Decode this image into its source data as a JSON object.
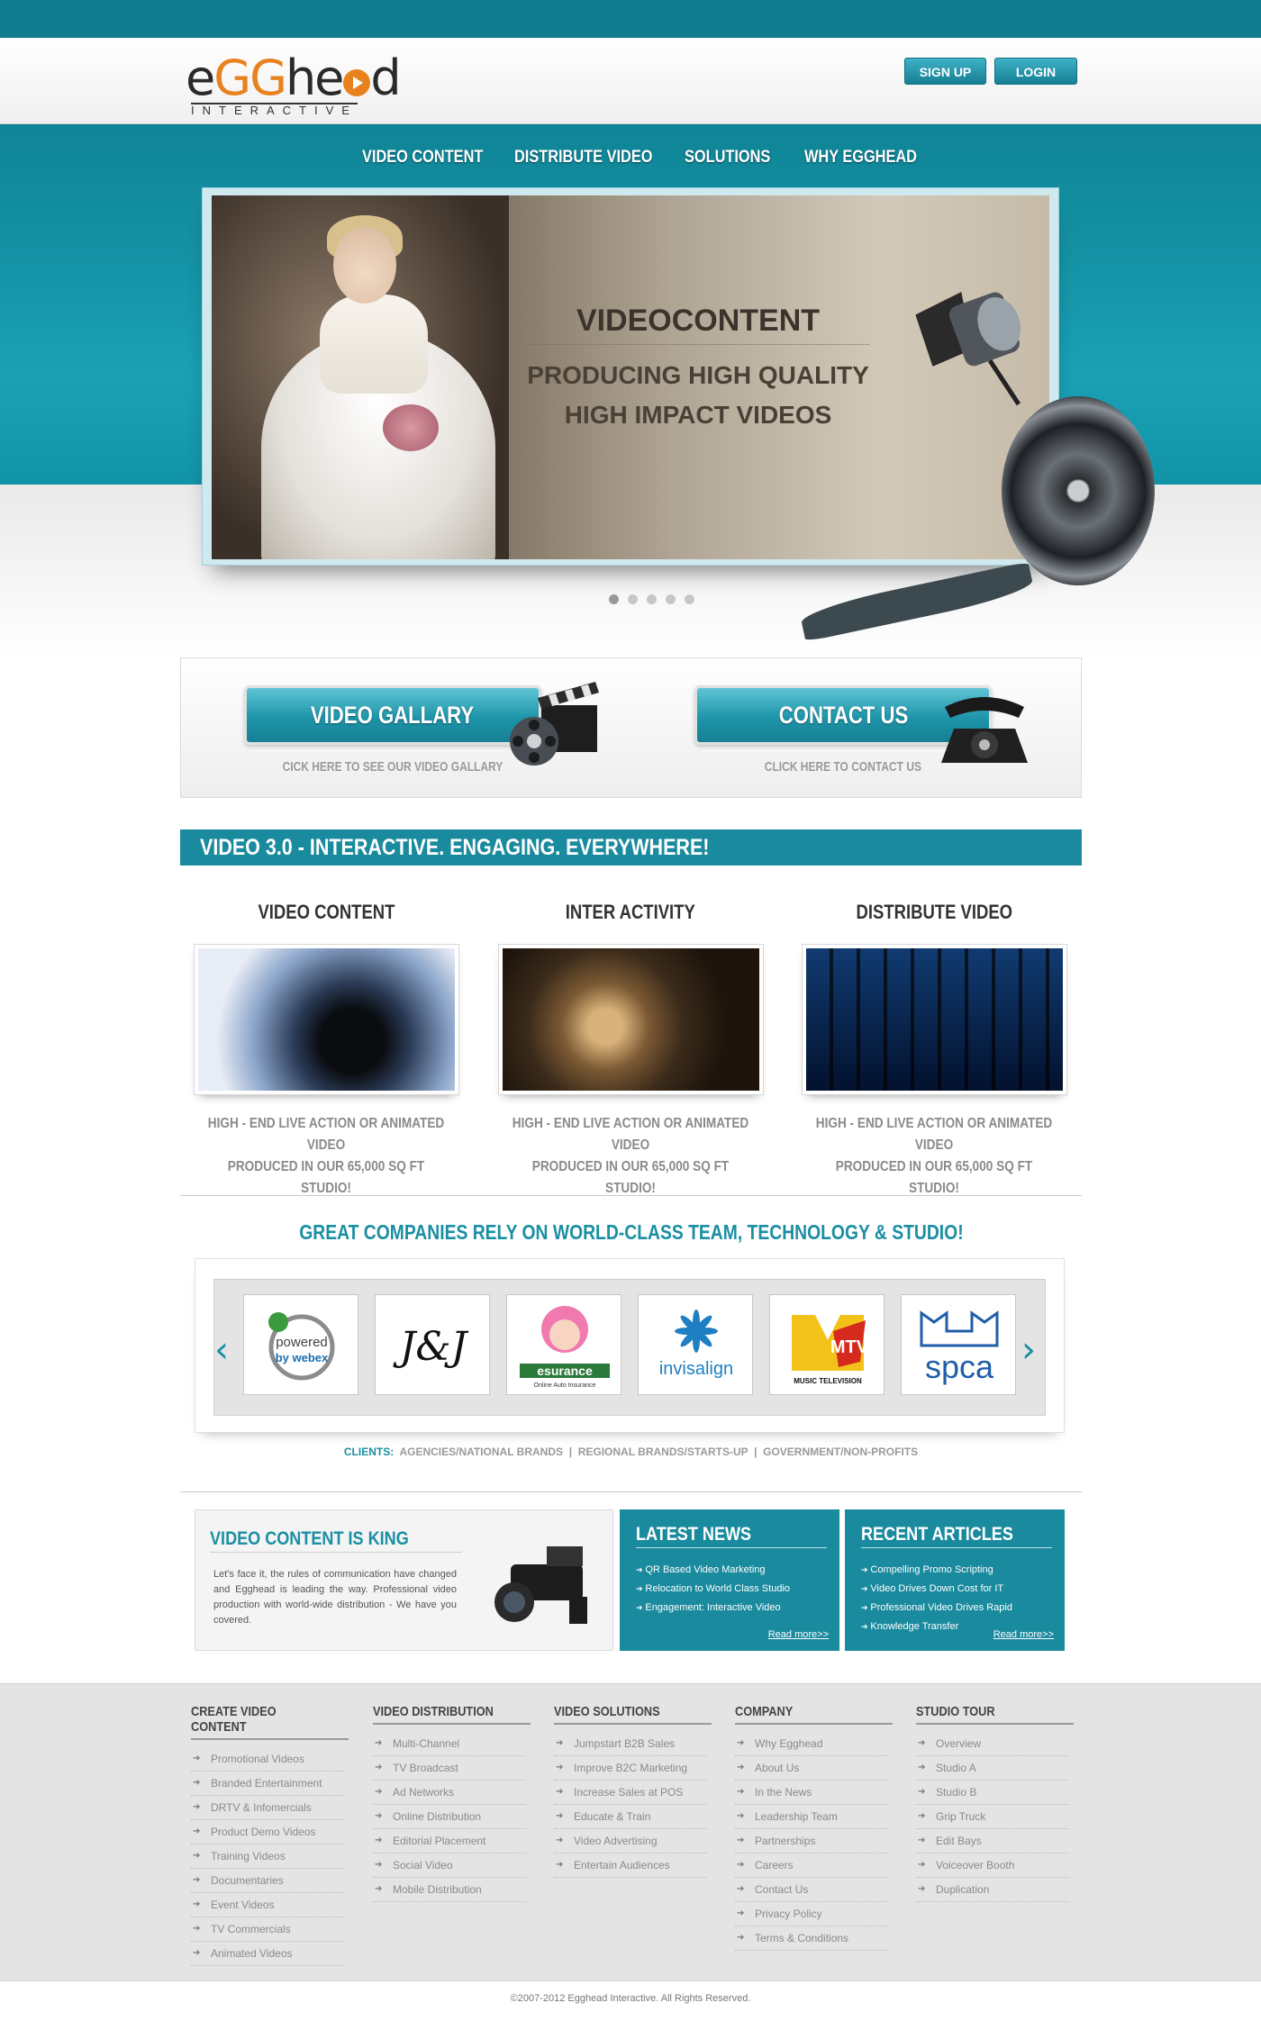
{
  "brand": {
    "logo_main_prefix": "e",
    "logo_main_gg": "GG",
    "logo_main_suffix": "he",
    "logo_main_end": "d",
    "logo_sub": "INTERACTIVE"
  },
  "header": {
    "signup_label": "SIGN UP",
    "login_label": "LOGIN"
  },
  "nav": {
    "items": [
      {
        "label": "VIDEO CONTENT"
      },
      {
        "label": "DISTRIBUTE VIDEO"
      },
      {
        "label": "SOLUTIONS"
      },
      {
        "label": "WHY EGGHEAD"
      }
    ]
  },
  "slider": {
    "title": "VIDEOCONTENT",
    "line1": "PRODUCING HIGH QUALITY",
    "line2": "HIGH IMPACT VIDEOS",
    "slide_count": 5,
    "active_index": 0
  },
  "cta": {
    "gallery_label": "VIDEO GALLARY",
    "gallery_sub": "CICK HERE TO SEE OUR VIDEO GALLARY",
    "contact_label": "CONTACT US",
    "contact_sub": "CLICK HERE TO CONTACT US"
  },
  "section_bar": "VIDEO 3.0 - INTERACTIVE. ENGAGING. EVERYWHERE!",
  "features": [
    {
      "title": "VIDEO CONTENT",
      "desc_line1": "HIGH - END LIVE ACTION OR ANIMATED VIDEO",
      "desc_line2": "PRODUCED IN OUR 65,000 SQ FT STUDIO!"
    },
    {
      "title": "INTER ACTIVITY",
      "desc_line1": "HIGH - END LIVE ACTION OR ANIMATED VIDEO",
      "desc_line2": "PRODUCED IN OUR 65,000 SQ FT STUDIO!"
    },
    {
      "title": "DISTRIBUTE VIDEO",
      "desc_line1": "HIGH - END LIVE ACTION OR ANIMATED VIDEO",
      "desc_line2": "PRODUCED IN OUR 65,000 SQ FT STUDIO!"
    }
  ],
  "companies": {
    "title": "GREAT COMPANIES RELY ON WORLD-CLASS TEAM, TECHNOLOGY & STUDIO!",
    "logos": [
      {
        "name": "webex",
        "text_top": "powered",
        "text_bottom": "by webex"
      },
      {
        "name": "jnj",
        "text_top": "J&J"
      },
      {
        "name": "esurance",
        "text_top": "esurance",
        "text_bottom": "Online Auto Insurance"
      },
      {
        "name": "invisalign",
        "text_top": "invisalign"
      },
      {
        "name": "mtv",
        "text_top": "MTV",
        "text_bottom": "MUSIC TELEVISION"
      },
      {
        "name": "spca",
        "text_top": "spca"
      }
    ],
    "clients_label": "CLIENTS:",
    "clients_links": [
      "AGENCIES/NATIONAL BRANDS",
      "REGIONAL BRANDS/STARTS-UP",
      "GOVERNMENT/NON-PROFITS"
    ],
    "separator": "|"
  },
  "king": {
    "title": "VIDEO CONTENT IS KING",
    "body": "Let's face it, the rules of communication have changed and Egghead is leading the way. Professional video production with world-wide distribution - We have you covered."
  },
  "news": {
    "title": "LATEST NEWS",
    "items": [
      "QR Based Video Marketing",
      "Relocation to World Class Studio",
      "Engagement: Interactive Video"
    ],
    "read_more": "Read more>>"
  },
  "articles": {
    "title": "RECENT ARTICLES",
    "items": [
      "Compelling Promo Scripting",
      "Video Drives Down Cost for IT",
      "Professional Video Drives Rapid",
      "Knowledge Transfer"
    ],
    "read_more": "Read more>>"
  },
  "footer": {
    "columns": [
      {
        "title": "CREATE VIDEO CONTENT",
        "items": [
          "Promotional Videos",
          "Branded Entertainment",
          "DRTV & Infomercials",
          "Product Demo Videos",
          "Training Videos",
          "Documentaries",
          "Event Videos",
          "TV Commercials",
          "Animated Videos"
        ]
      },
      {
        "title": "VIDEO DISTRIBUTION",
        "items": [
          "Multi-Channel",
          "TV Broadcast",
          "Ad Networks",
          "Online Distribution",
          "Editorial Placement",
          "Social Video",
          "Mobile Distribution"
        ]
      },
      {
        "title": "VIDEO SOLUTIONS",
        "items": [
          "Jumpstart B2B Sales",
          "Improve B2C Marketing",
          "Increase Sales at POS",
          "Educate & Train",
          "Video Advertising",
          "Entertain Audiences"
        ]
      },
      {
        "title": "COMPANY",
        "items": [
          "Why Egghead",
          "About Us",
          "In the News",
          "Leadership Team",
          "Partnerships",
          "Careers",
          "Contact Us",
          "Privacy Policy",
          "Terms & Conditions"
        ]
      },
      {
        "title": "STUDIO TOUR",
        "items": [
          "Overview",
          "Studio A",
          "Studio B",
          "Grip Truck",
          "Edit Bays",
          "Voiceover Booth",
          "Duplication"
        ]
      }
    ],
    "copyright": "©2007-2012 Egghead Interactive. All Rights Reserved."
  },
  "colors": {
    "teal": "#1a8a9e",
    "orange": "#e8821f",
    "top_band": "#117c8e"
  }
}
